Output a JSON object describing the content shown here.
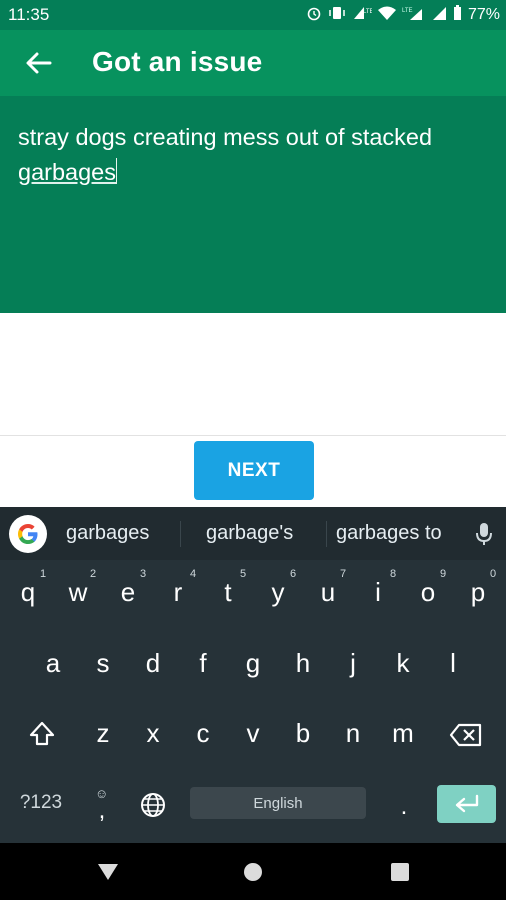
{
  "status_bar": {
    "time": "11:35",
    "battery": "77%",
    "icons": [
      "alarm-icon",
      "vibrate-icon",
      "volte-icon",
      "wifi-icon",
      "lte-signal-icon",
      "signal-icon",
      "battery-icon"
    ]
  },
  "app_bar": {
    "title": "Got an issue",
    "back_icon": "arrow-left-icon"
  },
  "issue": {
    "text_line1": "stray dogs creating mess out of stacked",
    "text_line2": "garbages"
  },
  "actions": {
    "next_label": "NEXT"
  },
  "keyboard": {
    "suggestions": [
      "garbages",
      "garbage's",
      "garbages to"
    ],
    "row1": [
      "q",
      "w",
      "e",
      "r",
      "t",
      "y",
      "u",
      "i",
      "o",
      "p"
    ],
    "row1_hints": [
      "1",
      "2",
      "3",
      "4",
      "5",
      "6",
      "7",
      "8",
      "9",
      "0"
    ],
    "row2": [
      "a",
      "s",
      "d",
      "f",
      "g",
      "h",
      "j",
      "k",
      "l"
    ],
    "row3": [
      "z",
      "x",
      "c",
      "v",
      "b",
      "n",
      "m"
    ],
    "symbols_key": "?123",
    "emoji_hint": "☺",
    "comma": ",",
    "period": ".",
    "space_label": "English"
  },
  "colors": {
    "status_bar": "#047e57",
    "app_bar": "#07925e",
    "issue_area": "#057e56",
    "next_button": "#1aa3e3",
    "keyboard_bg": "#263238",
    "enter_key": "#7fd1c3"
  }
}
